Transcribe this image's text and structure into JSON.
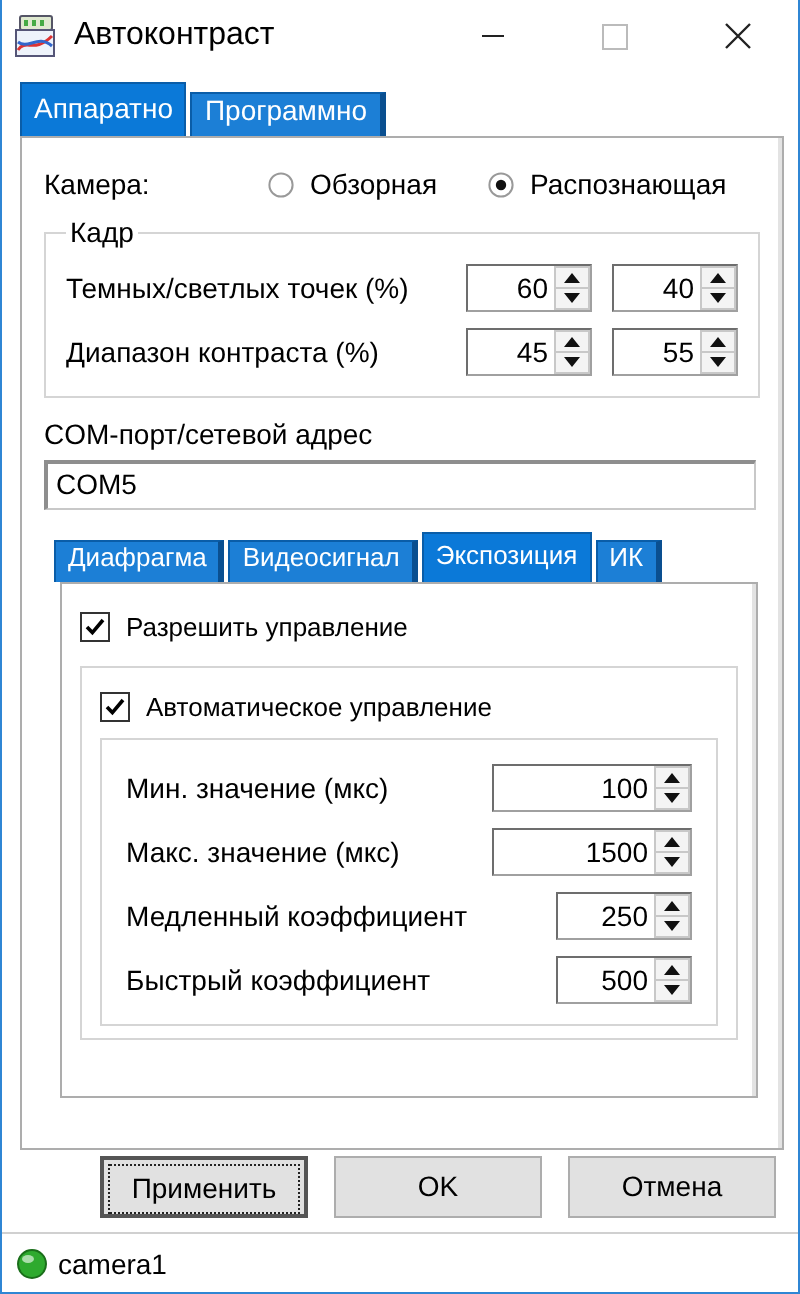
{
  "window": {
    "title": "Автоконтраст"
  },
  "tabs": [
    {
      "label": "Аппаратно",
      "selected": true
    },
    {
      "label": "Программно",
      "selected": false
    }
  ],
  "camera": {
    "label": "Камера:",
    "options": [
      {
        "label": "Обзорная",
        "selected": false
      },
      {
        "label": "Распознающая",
        "selected": true
      }
    ]
  },
  "frame_group": {
    "title": "Кадр",
    "rows": [
      {
        "label": "Темных/светлых точек (%)",
        "values": [
          "60",
          "40"
        ]
      },
      {
        "label": "Диапазон контраста (%)",
        "values": [
          "45",
          "55"
        ]
      }
    ]
  },
  "com_port": {
    "label": "COM-порт/сетевой адрес",
    "value": "COM5"
  },
  "sub_tabs": [
    {
      "label": "Диафрагма",
      "selected": false
    },
    {
      "label": "Видеосигнал",
      "selected": false
    },
    {
      "label": "Экспозиция",
      "selected": true
    },
    {
      "label": "ИК",
      "selected": false
    }
  ],
  "exposure": {
    "enable_control": {
      "label": "Разрешить управление",
      "checked": true
    },
    "auto_control": {
      "label": "Автоматическое управление",
      "checked": true
    },
    "fields": [
      {
        "label": "Мин. значение (мкс)",
        "value": "100"
      },
      {
        "label": "Макс. значение (мкс)",
        "value": "1500"
      },
      {
        "label": "Медленный коэффициент",
        "value": "250"
      },
      {
        "label": "Быстрый коэффициент",
        "value": "500"
      }
    ]
  },
  "buttons": [
    {
      "label": "Применить",
      "focused": true
    },
    {
      "label": "OK",
      "focused": false
    },
    {
      "label": "Отмена",
      "focused": false
    }
  ],
  "status_bar": {
    "text": "camera1",
    "connected": true
  }
}
